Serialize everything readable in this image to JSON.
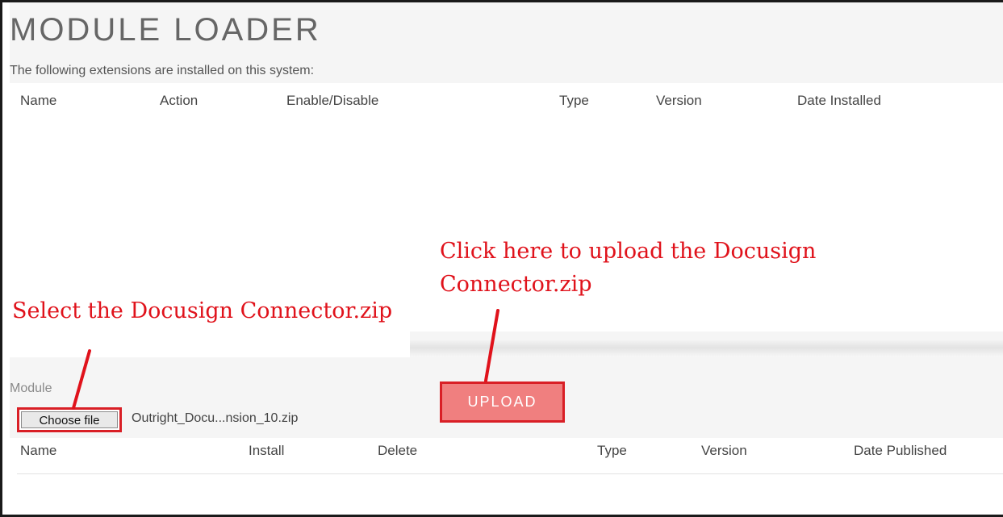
{
  "header": {
    "title": "MODULE LOADER",
    "intro_text": "The following extensions are installed on this system:"
  },
  "installed_table": {
    "columns": [
      "Name",
      "Action",
      "Enable/Disable",
      "Type",
      "Version",
      "Date Installed"
    ],
    "rows": []
  },
  "upload_form": {
    "module_label": "Module",
    "choose_file_label": "Choose file",
    "selected_file_name": "Outright_Docu...nsion_10.zip",
    "upload_button_label": "UPLOAD"
  },
  "published_table": {
    "columns": [
      "Name",
      "Install",
      "Delete",
      "Type",
      "Version",
      "Date Published"
    ],
    "rows": []
  },
  "annotations": {
    "select_note": "Select the Docusign Connector.zip",
    "upload_note_line1": "Click here to upload the Docusign",
    "upload_note_line2": "Connector.zip",
    "color": "#e0121b"
  },
  "colors": {
    "upload_button": "#f07f7f",
    "highlight_border": "#d91f26",
    "panel_background": "#f5f5f5"
  }
}
